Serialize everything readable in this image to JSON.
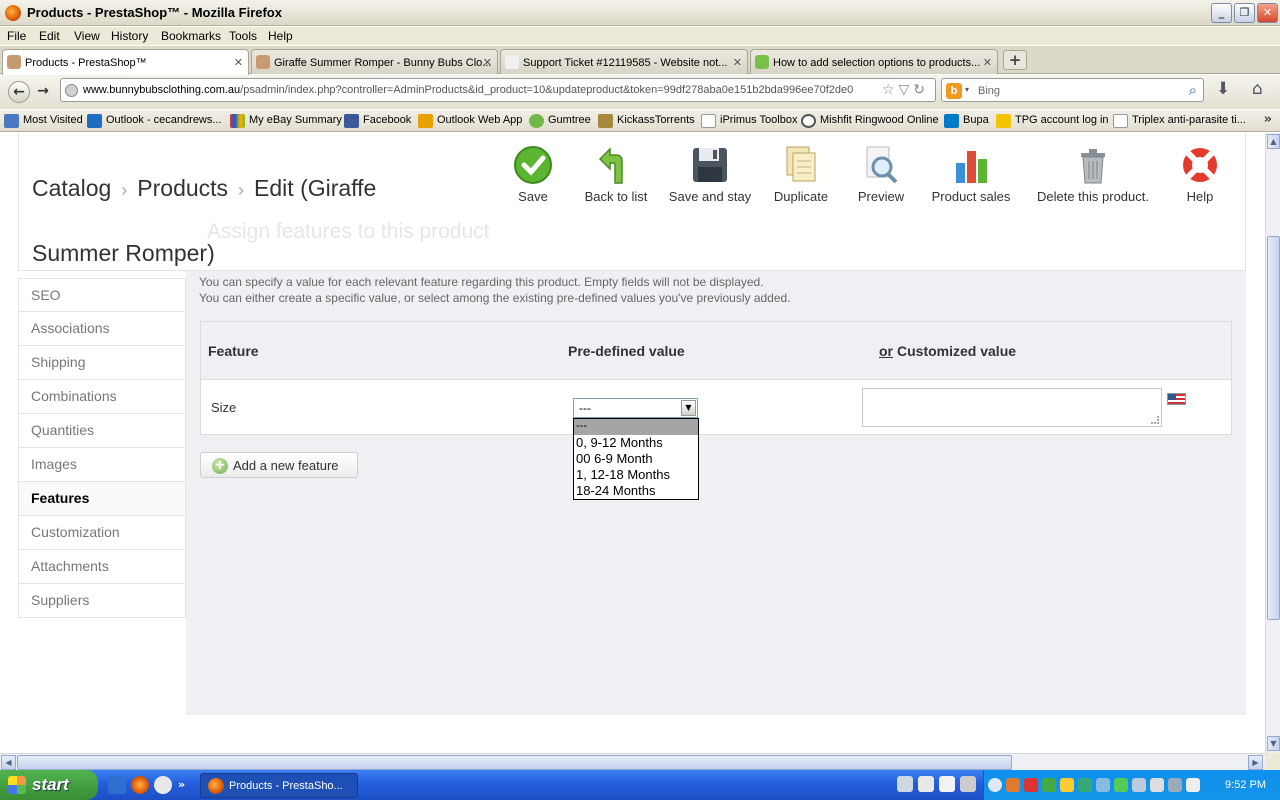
{
  "window": {
    "title": "Products - PrestaShop™ - Mozilla Firefox"
  },
  "menu": [
    "File",
    "Edit",
    "View",
    "History",
    "Bookmarks",
    "Tools",
    "Help"
  ],
  "tabs": [
    {
      "label": "Products - PrestaShop™"
    },
    {
      "label": "Giraffe Summer Romper - Bunny Bubs Clo..."
    },
    {
      "label": "Support Ticket #12119585 - Website not..."
    },
    {
      "label": "How to add selection options to products..."
    }
  ],
  "address": {
    "domain": "www.bunnybubsclothing.com.au",
    "path": "/psadmin/index.php?controller=AdminProducts&id_product=10&updateproduct&token=99df278aba0e151b2bda996ee70f2de0"
  },
  "search": {
    "placeholder": "Bing"
  },
  "bookmarks": [
    "Most Visited",
    "Outlook - cecandrews...",
    "My eBay Summary",
    "Facebook",
    "Outlook Web App",
    "Gumtree",
    "KickassTorrents",
    "iPrimus Toolbox",
    "Mishfit Ringwood Online",
    "Bupa",
    "TPG account log in",
    "Triplex anti-parasite ti..."
  ],
  "breadcrumb": {
    "catalog": "Catalog",
    "products": "Products",
    "edit": "Edit (Giraffe Summer Romper)"
  },
  "toolbar": {
    "save": "Save",
    "back": "Back to list",
    "save_stay": "Save and stay",
    "duplicate": "Duplicate",
    "preview": "Preview",
    "sales": "Product sales",
    "delete": "Delete this product.",
    "help": "Help"
  },
  "ghost_title": "Assign features to this product",
  "sidebar": [
    "SEO",
    "Associations",
    "Shipping",
    "Combinations",
    "Quantities",
    "Images",
    "Features",
    "Customization",
    "Attachments",
    "Suppliers"
  ],
  "hint": {
    "line1": "You can specify a value for each relevant feature regarding this product. Empty fields will not be displayed.",
    "line2": "You can either create a specific value, or select among the existing pre-defined values you've previously added."
  },
  "table": {
    "col_feature": "Feature",
    "col_predefined": "Pre-defined value",
    "col_or": "or",
    "col_custom": "Customized value",
    "row_feature": "Size",
    "selected": "---",
    "options": [
      "---",
      "0, 9-12 Months",
      "00 6-9 Month",
      "1, 12-18 Months",
      "18-24 Months"
    ]
  },
  "add_feature": "Add a new feature",
  "taskbar": {
    "start": "start",
    "task": "Products - PrestaSho...",
    "clock": "9:52 PM"
  },
  "colors": {
    "panel": "#eef0f3",
    "save_green": "#4caf32",
    "taskbar_blue": "#245edc"
  }
}
